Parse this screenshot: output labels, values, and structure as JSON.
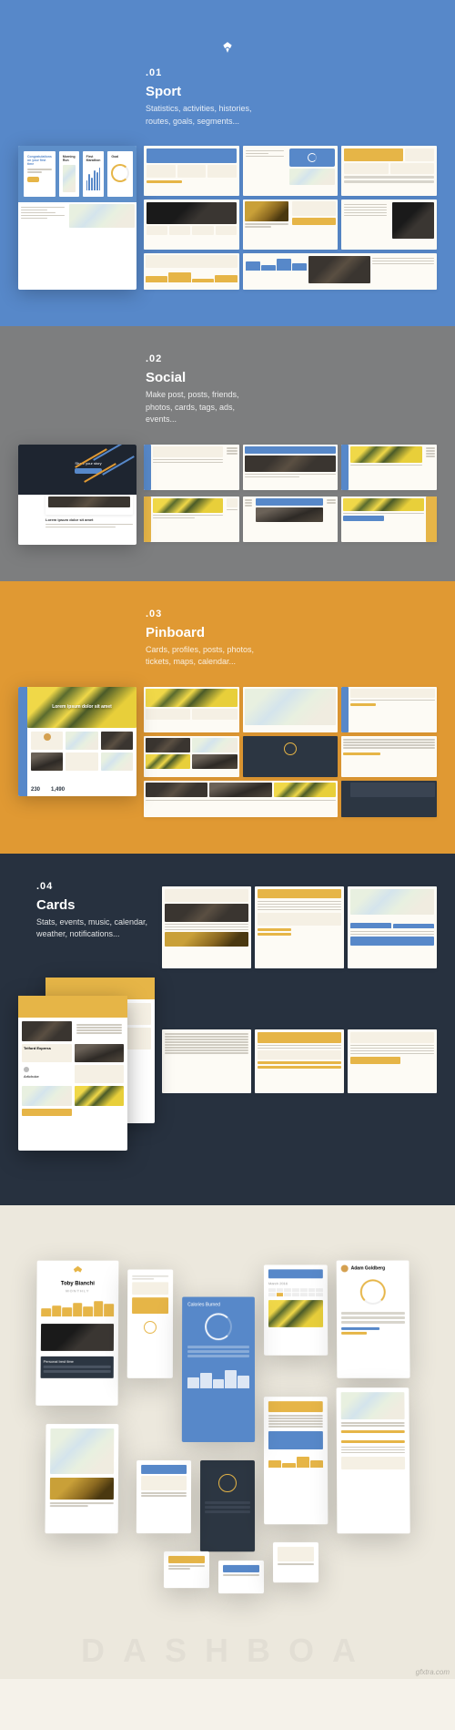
{
  "sections": [
    {
      "num": ".01",
      "title": "Sport",
      "desc": "Statistics, activities, histories, routes, goals, segments..."
    },
    {
      "num": ".02",
      "title": "Social",
      "desc": "Make post, posts, friends, photos, cards, tags, ads, events..."
    },
    {
      "num": ".03",
      "title": "Pinboard",
      "desc": "Cards, profiles, posts, photos, tickets, maps, calendar..."
    },
    {
      "num": ".04",
      "title": "Cards",
      "desc": "Stats, events, music, calendar, weather, notifications..."
    }
  ],
  "sport_cards": [
    {
      "title": "Congratulations on your first time"
    },
    {
      "title": "Morning Run"
    },
    {
      "title": "First Marathon"
    },
    {
      "title": "Goal"
    }
  ],
  "social_hero": {
    "cta": "Share your story",
    "headline": "Lorem ipsum dolor sit amet"
  },
  "pinboard": {
    "headline": "Lorem ipsum dolor sit amet",
    "stats": [
      {
        "v": "230"
      },
      {
        "v": "1,490"
      }
    ]
  },
  "cards_feature": {
    "title1": "Telford Express",
    "title2": "Artichoke"
  },
  "iso_cards": {
    "title": "Toby Bianchi",
    "monthly": "MONTHLY",
    "list_title": "Personal best time",
    "adam": "Adam Goldberg"
  },
  "watermark": "DASHBOA",
  "site": "gfxtra.com"
}
